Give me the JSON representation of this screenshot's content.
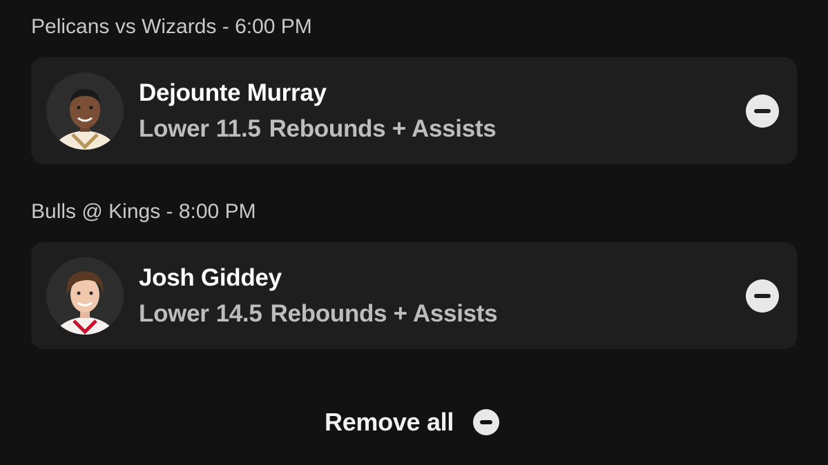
{
  "games": [
    {
      "header": "Pelicans vs Wizards - 6:00 PM",
      "pick": {
        "player": "Dejounte Murray",
        "direction": "Lower",
        "line": "11.5",
        "stat": "Rebounds + Assists",
        "avatar_icon": "player-headshot",
        "jersey_color": "#f3ead8",
        "jersey_trim": "#b8955a"
      }
    },
    {
      "header": "Bulls @ Kings - 8:00 PM",
      "pick": {
        "player": "Josh Giddey",
        "direction": "Lower",
        "line": "14.5",
        "stat": "Rebounds + Assists",
        "avatar_icon": "player-headshot",
        "jersey_color": "#f4f1ee",
        "jersey_trim": "#c8102e"
      }
    }
  ],
  "footer": {
    "remove_all_label": "Remove all",
    "remove_all_icon": "minus-circle-icon"
  },
  "colors": {
    "background": "#121212",
    "card": "#1e1e1e",
    "header_text": "#c9c9c9",
    "secondary_text": "#bdbdbd",
    "icon_fill": "#e8e8e8"
  }
}
